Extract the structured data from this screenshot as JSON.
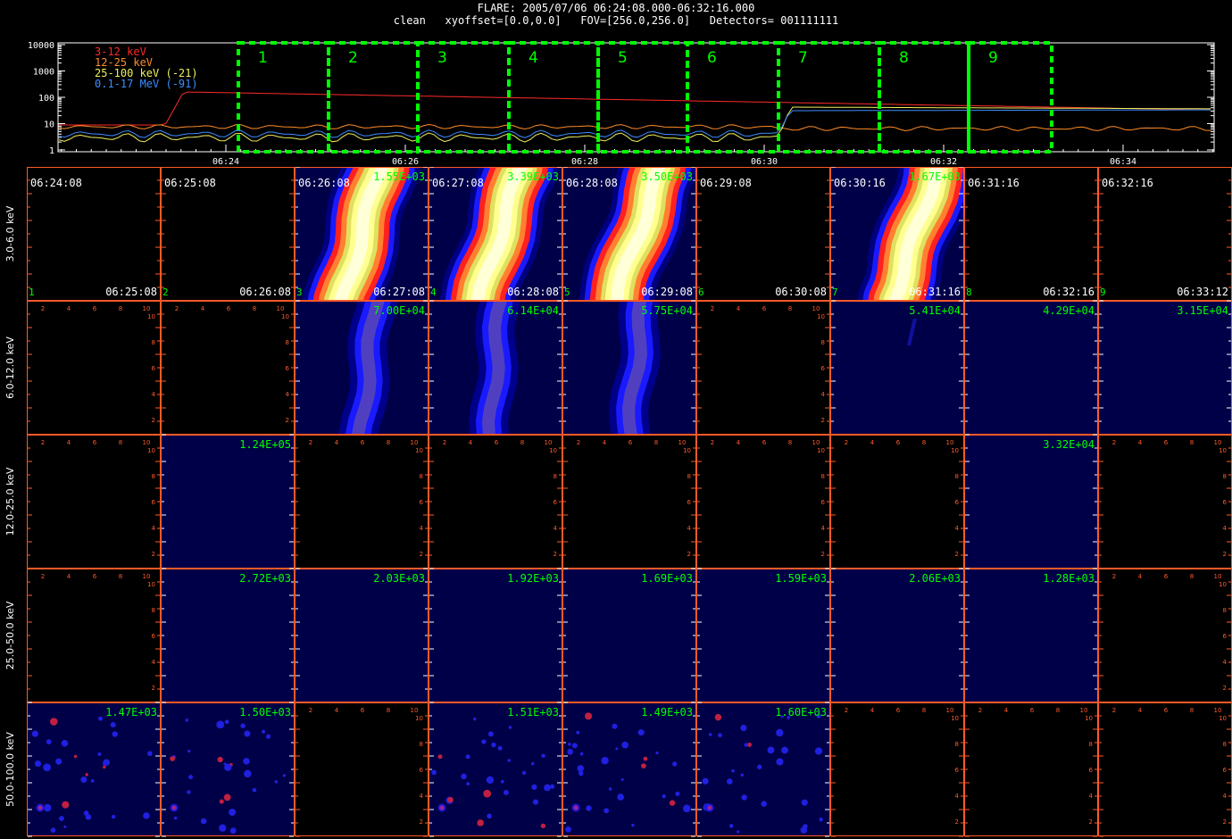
{
  "header": {
    "title": "FLARE: 2005/07/06 06:24:08.000-06:32:16.000",
    "subtitle": "clean   xyoffset=[0.0,0.0]   FOV=[256.0,256.0]   Detectors= 001111111"
  },
  "lightcurve": {
    "ytick_labels": [
      "10000",
      "1000",
      "100",
      "10",
      "1"
    ],
    "xtick_labels": [
      "06:24",
      "06:26",
      "06:28",
      "06:30",
      "06:32",
      "06:34"
    ],
    "legend": [
      {
        "label": "3-12 keV",
        "color": "#ff2a2a"
      },
      {
        "label": "12-25 keV",
        "color": "#ff8c28"
      },
      {
        "label": "25-100 keV (-21)",
        "color": "#f0f05a"
      },
      {
        "label": "0.1-17 MeV (-91)",
        "color": "#3c8cff"
      }
    ],
    "interval_numbers": [
      "1",
      "2",
      "3",
      "4",
      "5",
      "6",
      "7",
      "8",
      "9"
    ],
    "interval_color": "#00ff00"
  },
  "grid": {
    "rows": [
      "3.0-6.0 keV",
      "6.0-12.0 keV",
      "12.0-25.0 keV",
      "25.0-50.0 keV",
      "50.0-100.0 keV"
    ],
    "start_times": [
      "06:24:08",
      "06:25:08",
      "06:26:08",
      "06:27:08",
      "06:28:08",
      "06:29:08",
      "06:30:16",
      "06:31:16",
      "06:32:16"
    ],
    "end_times": [
      "06:25:08",
      "06:26:08",
      "06:27:08",
      "06:28:08",
      "06:29:08",
      "06:30:08",
      "06:31:16",
      "06:32:16",
      "06:33:12"
    ],
    "col_numbers": [
      "1",
      "2",
      "3",
      "4",
      "5",
      "6",
      "7",
      "8",
      "9"
    ],
    "axis_ticks": [
      "2",
      "4",
      "6",
      "8",
      "10"
    ],
    "max_values": [
      [
        "",
        "",
        "1.55E+03",
        "3.39E+03",
        "3.50E+03",
        "",
        "1.67E+03",
        "",
        ""
      ],
      [
        "",
        "",
        "7.00E+04",
        "6.14E+04",
        "5.75E+04",
        "",
        "5.41E+04",
        "4.29E+04",
        "3.15E+04"
      ],
      [
        "",
        "1.24E+05",
        "",
        "",
        "",
        "",
        "",
        "3.32E+04",
        ""
      ],
      [
        "",
        "2.72E+03",
        "2.03E+03",
        "1.92E+03",
        "1.69E+03",
        "1.59E+03",
        "2.06E+03",
        "1.28E+03",
        ""
      ],
      [
        "1.47E+03",
        "1.50E+03",
        "",
        "1.51E+03",
        "1.49E+03",
        "1.60E+03",
        "",
        "",
        ""
      ]
    ],
    "colors": {
      "frame": "#ff5a28",
      "value_text": "#00ff00",
      "tick_text": "#ff5a28"
    }
  }
}
